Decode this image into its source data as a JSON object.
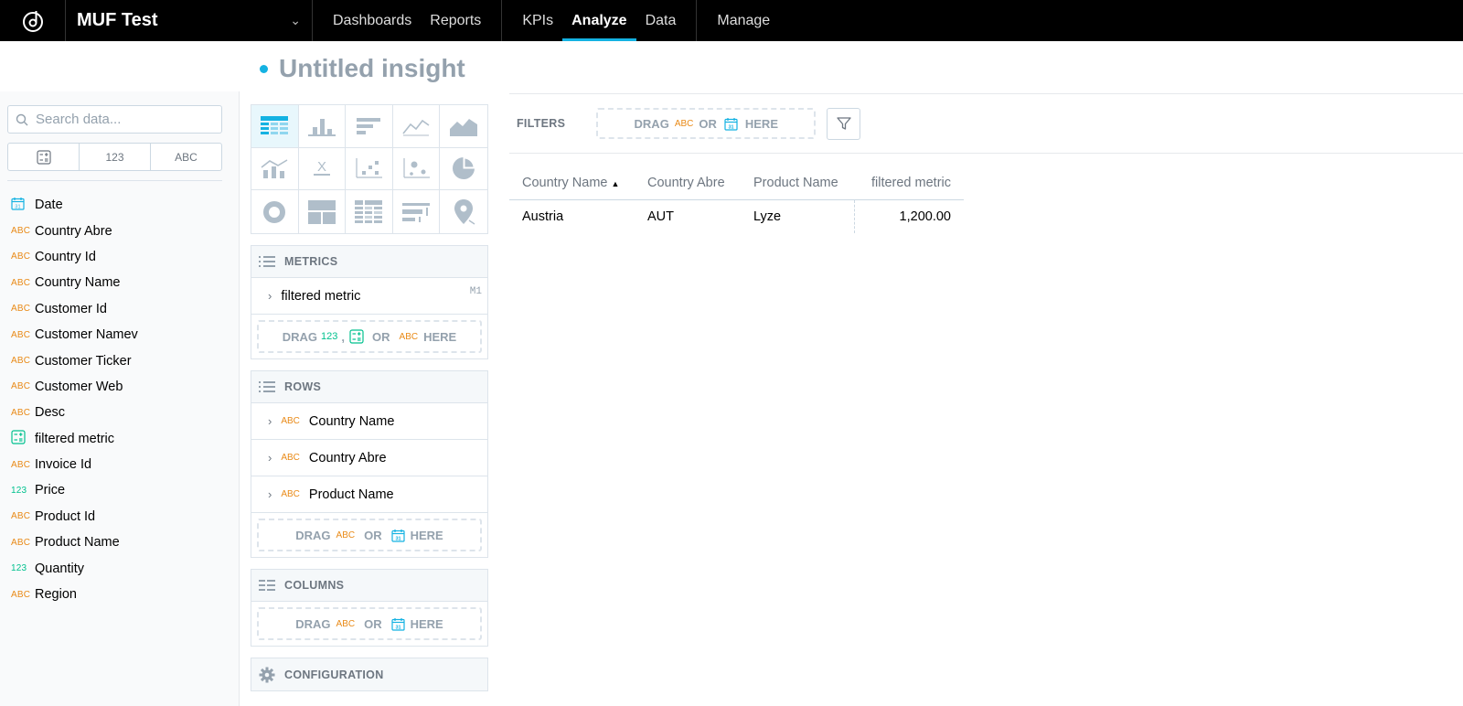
{
  "app": {
    "workspace": "MUF Test",
    "nav_primary": [
      "Dashboards",
      "Reports"
    ],
    "nav_analyze": [
      "KPIs",
      "Analyze",
      "Data"
    ],
    "nav_manage": "Manage",
    "active_nav": "Analyze",
    "accent_color": "#14b2e2"
  },
  "insight": {
    "title": "Untitled insight"
  },
  "catalog": {
    "search_placeholder": "Search data...",
    "type_filters": [
      "123",
      "ABC"
    ],
    "items": [
      {
        "type": "date",
        "label": "Date"
      },
      {
        "type": "ABC",
        "label": "Country Abre"
      },
      {
        "type": "ABC",
        "label": "Country Id"
      },
      {
        "type": "ABC",
        "label": "Country Name"
      },
      {
        "type": "ABC",
        "label": "Customer Id"
      },
      {
        "type": "ABC",
        "label": "Customer Namev"
      },
      {
        "type": "ABC",
        "label": "Customer Ticker"
      },
      {
        "type": "ABC",
        "label": "Customer Web"
      },
      {
        "type": "ABC",
        "label": "Desc"
      },
      {
        "type": "metric",
        "label": "filtered metric"
      },
      {
        "type": "ABC",
        "label": "Invoice Id"
      },
      {
        "type": "123",
        "label": "Price"
      },
      {
        "type": "ABC",
        "label": "Product Id"
      },
      {
        "type": "ABC",
        "label": "Product Name"
      },
      {
        "type": "123",
        "label": "Quantity"
      },
      {
        "type": "ABC",
        "label": "Region"
      }
    ]
  },
  "buckets": {
    "metrics": {
      "title": "METRICS",
      "items": [
        {
          "label": "filtered metric",
          "tag": "M1"
        }
      ],
      "drop": {
        "drag": "DRAG",
        "num": "123",
        "comma": ",",
        "or": "OR",
        "abc": "ABC",
        "here": "HERE"
      }
    },
    "rows": {
      "title": "ROWS",
      "items": [
        {
          "type": "ABC",
          "label": "Country Name"
        },
        {
          "type": "ABC",
          "label": "Country Abre"
        },
        {
          "type": "ABC",
          "label": "Product Name"
        }
      ],
      "drop": {
        "drag": "DRAG",
        "abc": "ABC",
        "or": "OR",
        "here": "HERE"
      }
    },
    "columns": {
      "title": "COLUMNS",
      "drop": {
        "drag": "DRAG",
        "abc": "ABC",
        "or": "OR",
        "here": "HERE"
      }
    },
    "configuration": "CONFIGURATION"
  },
  "filters": {
    "label": "FILTERS",
    "drop": {
      "drag": "DRAG",
      "abc": "ABC",
      "or": "OR",
      "here": "HERE"
    }
  },
  "table": {
    "headers": [
      "Country Name",
      "Country Abre",
      "Product Name",
      "filtered metric"
    ],
    "sort": {
      "column": "Country Name",
      "direction": "ascending"
    },
    "rows": [
      [
        "Austria",
        "AUT",
        "Lyze",
        "1,200.00"
      ]
    ]
  }
}
